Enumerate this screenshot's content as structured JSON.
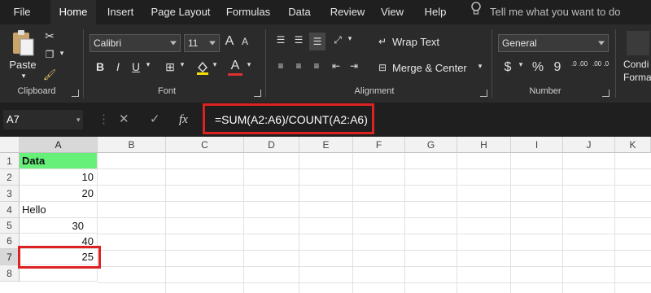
{
  "tabs": [
    "File",
    "Home",
    "Insert",
    "Page Layout",
    "Formulas",
    "Data",
    "Review",
    "View",
    "Help"
  ],
  "active_tab": "Home",
  "tell_me": "Tell me what you want to do",
  "ribbon": {
    "clipboard": {
      "label": "Clipboard",
      "paste": "Paste"
    },
    "font": {
      "label": "Font",
      "name": "Calibri",
      "size": "11",
      "bold": "B",
      "italic": "I",
      "underline": "U",
      "grow": "A",
      "shrink": "A",
      "font_color": "A"
    },
    "alignment": {
      "label": "Alignment",
      "wrap": "Wrap Text",
      "merge": "Merge & Center"
    },
    "number": {
      "label": "Number",
      "format": "General",
      "currency": "$",
      "percent": "%",
      "comma": "9",
      "inc": ".0 .00",
      "dec": ".00 .0"
    },
    "styles": {
      "cond": "Condi",
      "format": "Forma"
    }
  },
  "formula_bar": {
    "name_box": "A7",
    "fx": "fx",
    "cancel": "✕",
    "enter": "✓",
    "formula": "=SUM(A2:A6)/COUNT(A2:A6)"
  },
  "columns": [
    "A",
    "B",
    "C",
    "D",
    "E",
    "F",
    "G",
    "H",
    "I",
    "J",
    "K"
  ],
  "rows": [
    "1",
    "2",
    "3",
    "4",
    "5",
    "6",
    "7",
    "8"
  ],
  "cells": {
    "A1": "Data",
    "A2": "10",
    "A3": "20",
    "A4": "Hello",
    "A5": "30",
    "A6": "40",
    "A7": "25"
  },
  "colors": {
    "header_fill": "#66f07a",
    "highlight": "#dd2222",
    "ribbon_bg": "#2b2b2b"
  }
}
